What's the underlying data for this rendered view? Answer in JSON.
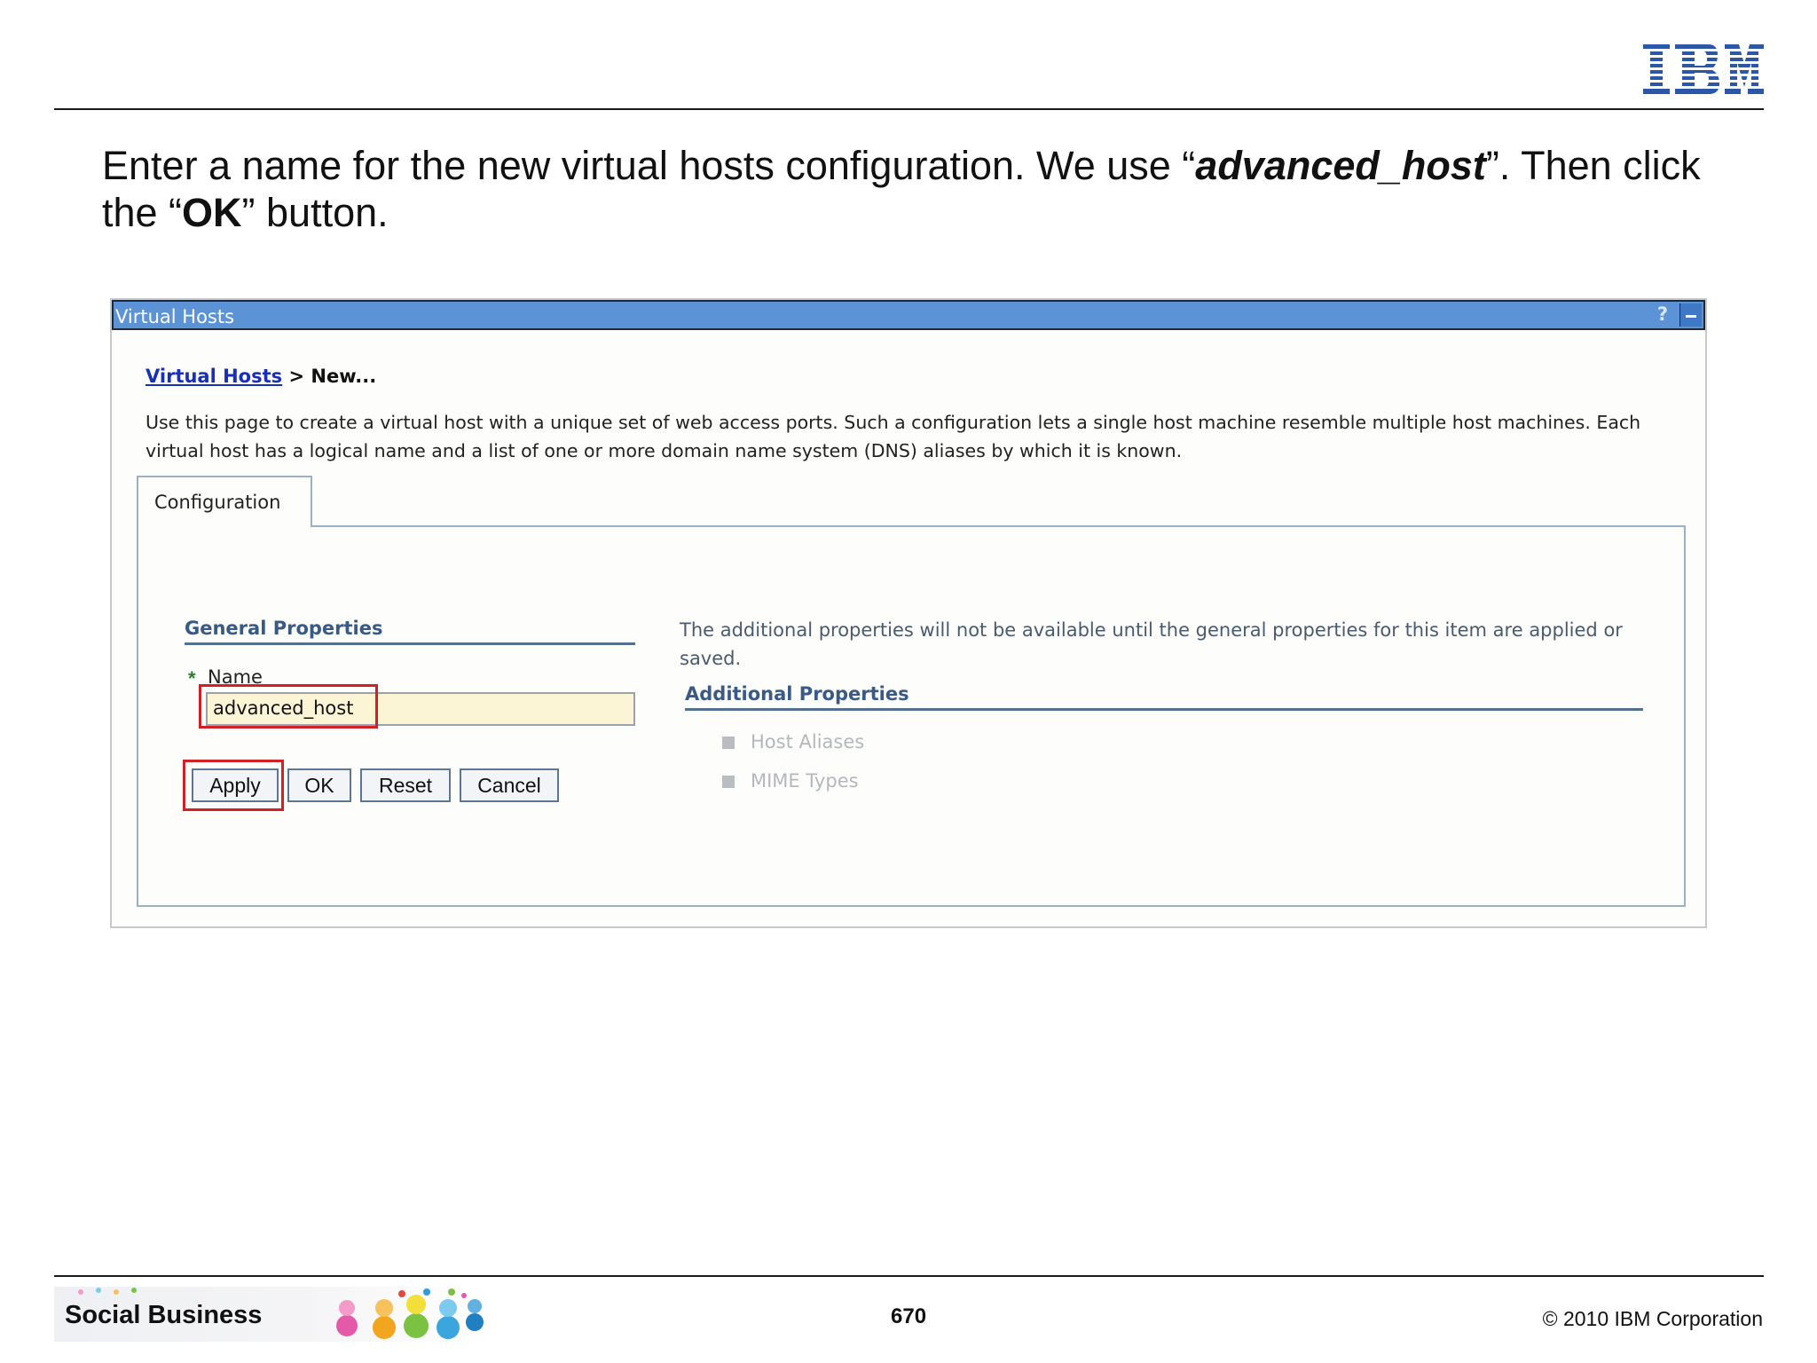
{
  "slide": {
    "title_part1": "Enter a name for the new virtual hosts configuration. We use “",
    "title_em": "advanced_host",
    "title_part2": "”. Then click the “",
    "title_bold": "OK",
    "title_part3": "” button.",
    "logo": "IBM"
  },
  "window": {
    "title": "Virtual Hosts",
    "help_icon": "?",
    "minimize_icon": "minimize-icon"
  },
  "breadcrumb": {
    "link": "Virtual Hosts",
    "separator": " > ",
    "current": "New..."
  },
  "description": "Use this page to create a virtual host with a unique set of web access ports. Such a configuration lets a single host machine resemble multiple host machines. Each virtual host has a logical name and a list of one or more domain name system (DNS) aliases by which it is known.",
  "tabs": [
    {
      "label": "Configuration"
    }
  ],
  "general": {
    "heading": "General Properties",
    "required_marker": "*",
    "name_label": "Name",
    "name_value": "advanced_host"
  },
  "buttons": {
    "apply": "Apply",
    "ok": "OK",
    "reset": "Reset",
    "cancel": "Cancel"
  },
  "additional": {
    "note": "The additional properties will not be available until the general properties for this item are applied or saved.",
    "heading": "Additional Properties",
    "items": [
      "Host Aliases",
      "MIME Types"
    ]
  },
  "footer": {
    "banner": "Social Business",
    "page_number": "670",
    "copyright": "© 2010 IBM Corporation"
  },
  "colors": {
    "titlebar": "#5b93d6",
    "highlight": "#d31f26",
    "heading": "#3a5a86",
    "input_bg": "#fbf5d6"
  }
}
